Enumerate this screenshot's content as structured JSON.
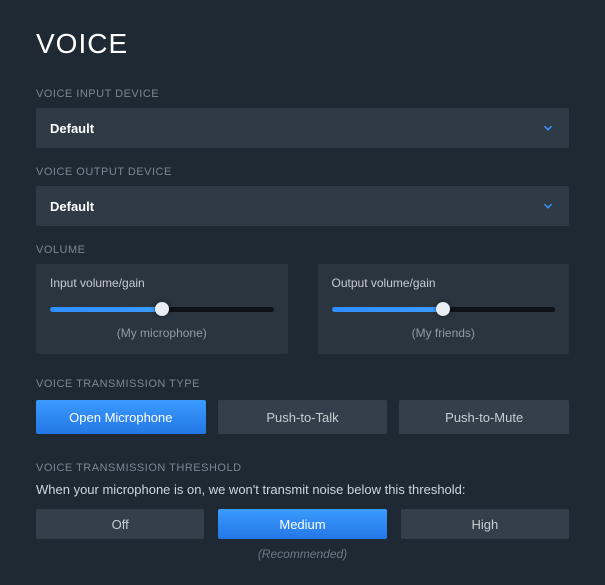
{
  "title": "VOICE",
  "inputDevice": {
    "label": "VOICE INPUT DEVICE",
    "value": "Default"
  },
  "outputDevice": {
    "label": "VOICE OUTPUT DEVICE",
    "value": "Default"
  },
  "volume": {
    "label": "VOLUME",
    "input": {
      "title": "Input volume/gain",
      "caption": "(My microphone)",
      "percent": 50
    },
    "output": {
      "title": "Output volume/gain",
      "caption": "(My friends)",
      "percent": 50
    }
  },
  "transmissionType": {
    "label": "VOICE TRANSMISSION TYPE",
    "options": [
      "Open Microphone",
      "Push-to-Talk",
      "Push-to-Mute"
    ],
    "active": 0
  },
  "threshold": {
    "label": "VOICE TRANSMISSION THRESHOLD",
    "desc": "When your microphone is on, we won't transmit noise below this threshold:",
    "options": [
      "Off",
      "Medium",
      "High"
    ],
    "active": 1,
    "recommended": "(Recommended)"
  }
}
